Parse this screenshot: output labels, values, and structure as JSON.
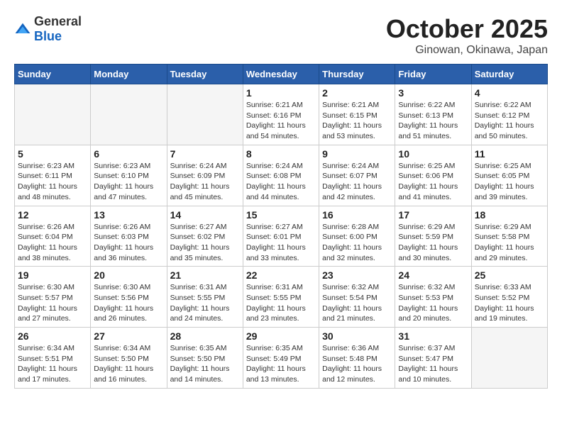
{
  "header": {
    "logo_general": "General",
    "logo_blue": "Blue",
    "month": "October 2025",
    "location": "Ginowan, Okinawa, Japan"
  },
  "weekdays": [
    "Sunday",
    "Monday",
    "Tuesday",
    "Wednesday",
    "Thursday",
    "Friday",
    "Saturday"
  ],
  "weeks": [
    [
      {
        "day": "",
        "info": ""
      },
      {
        "day": "",
        "info": ""
      },
      {
        "day": "",
        "info": ""
      },
      {
        "day": "1",
        "info": "Sunrise: 6:21 AM\nSunset: 6:16 PM\nDaylight: 11 hours\nand 54 minutes."
      },
      {
        "day": "2",
        "info": "Sunrise: 6:21 AM\nSunset: 6:15 PM\nDaylight: 11 hours\nand 53 minutes."
      },
      {
        "day": "3",
        "info": "Sunrise: 6:22 AM\nSunset: 6:13 PM\nDaylight: 11 hours\nand 51 minutes."
      },
      {
        "day": "4",
        "info": "Sunrise: 6:22 AM\nSunset: 6:12 PM\nDaylight: 11 hours\nand 50 minutes."
      }
    ],
    [
      {
        "day": "5",
        "info": "Sunrise: 6:23 AM\nSunset: 6:11 PM\nDaylight: 11 hours\nand 48 minutes."
      },
      {
        "day": "6",
        "info": "Sunrise: 6:23 AM\nSunset: 6:10 PM\nDaylight: 11 hours\nand 47 minutes."
      },
      {
        "day": "7",
        "info": "Sunrise: 6:24 AM\nSunset: 6:09 PM\nDaylight: 11 hours\nand 45 minutes."
      },
      {
        "day": "8",
        "info": "Sunrise: 6:24 AM\nSunset: 6:08 PM\nDaylight: 11 hours\nand 44 minutes."
      },
      {
        "day": "9",
        "info": "Sunrise: 6:24 AM\nSunset: 6:07 PM\nDaylight: 11 hours\nand 42 minutes."
      },
      {
        "day": "10",
        "info": "Sunrise: 6:25 AM\nSunset: 6:06 PM\nDaylight: 11 hours\nand 41 minutes."
      },
      {
        "day": "11",
        "info": "Sunrise: 6:25 AM\nSunset: 6:05 PM\nDaylight: 11 hours\nand 39 minutes."
      }
    ],
    [
      {
        "day": "12",
        "info": "Sunrise: 6:26 AM\nSunset: 6:04 PM\nDaylight: 11 hours\nand 38 minutes."
      },
      {
        "day": "13",
        "info": "Sunrise: 6:26 AM\nSunset: 6:03 PM\nDaylight: 11 hours\nand 36 minutes."
      },
      {
        "day": "14",
        "info": "Sunrise: 6:27 AM\nSunset: 6:02 PM\nDaylight: 11 hours\nand 35 minutes."
      },
      {
        "day": "15",
        "info": "Sunrise: 6:27 AM\nSunset: 6:01 PM\nDaylight: 11 hours\nand 33 minutes."
      },
      {
        "day": "16",
        "info": "Sunrise: 6:28 AM\nSunset: 6:00 PM\nDaylight: 11 hours\nand 32 minutes."
      },
      {
        "day": "17",
        "info": "Sunrise: 6:29 AM\nSunset: 5:59 PM\nDaylight: 11 hours\nand 30 minutes."
      },
      {
        "day": "18",
        "info": "Sunrise: 6:29 AM\nSunset: 5:58 PM\nDaylight: 11 hours\nand 29 minutes."
      }
    ],
    [
      {
        "day": "19",
        "info": "Sunrise: 6:30 AM\nSunset: 5:57 PM\nDaylight: 11 hours\nand 27 minutes."
      },
      {
        "day": "20",
        "info": "Sunrise: 6:30 AM\nSunset: 5:56 PM\nDaylight: 11 hours\nand 26 minutes."
      },
      {
        "day": "21",
        "info": "Sunrise: 6:31 AM\nSunset: 5:55 PM\nDaylight: 11 hours\nand 24 minutes."
      },
      {
        "day": "22",
        "info": "Sunrise: 6:31 AM\nSunset: 5:55 PM\nDaylight: 11 hours\nand 23 minutes."
      },
      {
        "day": "23",
        "info": "Sunrise: 6:32 AM\nSunset: 5:54 PM\nDaylight: 11 hours\nand 21 minutes."
      },
      {
        "day": "24",
        "info": "Sunrise: 6:32 AM\nSunset: 5:53 PM\nDaylight: 11 hours\nand 20 minutes."
      },
      {
        "day": "25",
        "info": "Sunrise: 6:33 AM\nSunset: 5:52 PM\nDaylight: 11 hours\nand 19 minutes."
      }
    ],
    [
      {
        "day": "26",
        "info": "Sunrise: 6:34 AM\nSunset: 5:51 PM\nDaylight: 11 hours\nand 17 minutes."
      },
      {
        "day": "27",
        "info": "Sunrise: 6:34 AM\nSunset: 5:50 PM\nDaylight: 11 hours\nand 16 minutes."
      },
      {
        "day": "28",
        "info": "Sunrise: 6:35 AM\nSunset: 5:50 PM\nDaylight: 11 hours\nand 14 minutes."
      },
      {
        "day": "29",
        "info": "Sunrise: 6:35 AM\nSunset: 5:49 PM\nDaylight: 11 hours\nand 13 minutes."
      },
      {
        "day": "30",
        "info": "Sunrise: 6:36 AM\nSunset: 5:48 PM\nDaylight: 11 hours\nand 12 minutes."
      },
      {
        "day": "31",
        "info": "Sunrise: 6:37 AM\nSunset: 5:47 PM\nDaylight: 11 hours\nand 10 minutes."
      },
      {
        "day": "",
        "info": ""
      }
    ]
  ]
}
